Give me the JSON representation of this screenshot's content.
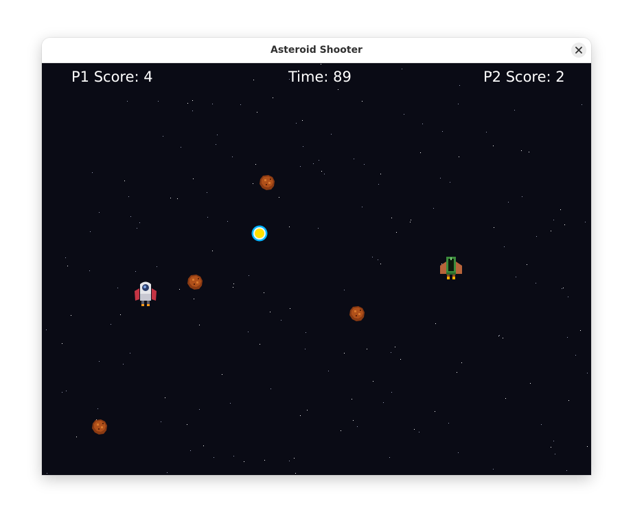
{
  "window": {
    "title": "Asteroid Shooter"
  },
  "hud": {
    "p1_score": "P1 Score: 4",
    "timer": "Time: 89",
    "p2_score": "P2 Score: 2"
  },
  "colors": {
    "space_background": "#0a0b15",
    "asteroid": "#b0501a",
    "bullet_outer": "#00b4ff",
    "bullet_inner": "#ffe000",
    "player1_accent": "#d33a4a",
    "player2_hull": "#3c8c3c",
    "player2_wings": "#b8643a"
  },
  "icons": {
    "close": "close-icon",
    "player1": "white-rocket-ship-icon",
    "player2": "green-rocket-ship-icon",
    "asteroid": "asteroid-icon",
    "bullet": "energy-orb-icon"
  }
}
